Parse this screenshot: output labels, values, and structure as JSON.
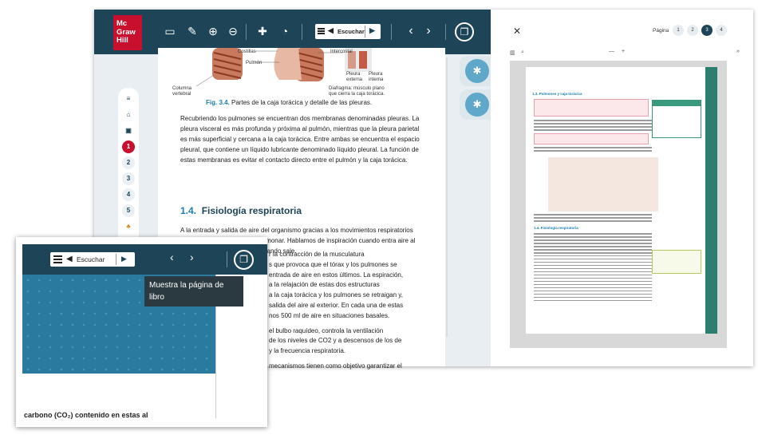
{
  "toolbar": {
    "logo_line1": "Mc",
    "logo_line2": "Graw",
    "logo_line3": "Hill",
    "audio_label": "Escuchar"
  },
  "sidebar": {
    "items": [
      "1",
      "2",
      "3",
      "4",
      "5"
    ]
  },
  "figure": {
    "labels": [
      "Costillas",
      "Pulmón",
      "Columna vertebral",
      "Intercostal",
      "Pleura externa",
      "Pleura interna"
    ],
    "diaphragm_note": "Diafragma: músculo plano que cierra la caja torácica.",
    "caption_num": "Fig. 3.4.",
    "caption_text": " Partes de la caja torácica y detalle de las pleuras."
  },
  "content": {
    "p1": "Recubriendo los pulmones se encuentran dos membranas denominadas pleuras. La pleura visceral es más profunda y próxima al pulmón, mientras que la pleura parietal es más superficial y cercana a la caja torácica. Entre ambas se encuentra el espacio pleural, que contiene un líquido lubricante denominado líquido pleural. La función de estas membranas es evitar el contacto directo entre el pulmón y la caja torácica.",
    "section_num": "1.4.",
    "section_title": "Fisiología respiratoria",
    "p2": "A la entrada y salida de aire del organismo gracias a los movimientos respiratorios se la denomina ventilación pulmonar. Hablamos de inspiración cuando entra aire al organismo, y de espiración, cuando sale."
  },
  "right": {
    "close": "✕",
    "page_label": "Página",
    "pages": [
      "1",
      "2",
      "3",
      "4"
    ],
    "mini_title": "1.3. Pulmones y caja torácica",
    "mini_section": "1.4. Fisiología respiratoria"
  },
  "zoom": {
    "audio_label": "Escuchar",
    "tooltip": "Muestra la página de libro",
    "lines": [
      "r la contracción de la musculatura",
      "s que provoca que el tórax y los pulmones se",
      "entrada de aire en estos últimos. La espiración,",
      "a la relajación de estas dos estructuras",
      "a la caja torácica y los pulmones se retraigan y,",
      "salida del aire al exterior. En cada una de estas",
      "nos 500 ml de aire en situaciones basales.",
      "el bulbo raquídeo, controla la ventilación",
      "de los niveles de CO2 y a descensos de los de",
      "y la frecuencia respiratoria.",
      "mecanismos tienen como objetivo garantizar el"
    ],
    "bottom_text": "carbono (CO₂) contenido en estas al"
  }
}
